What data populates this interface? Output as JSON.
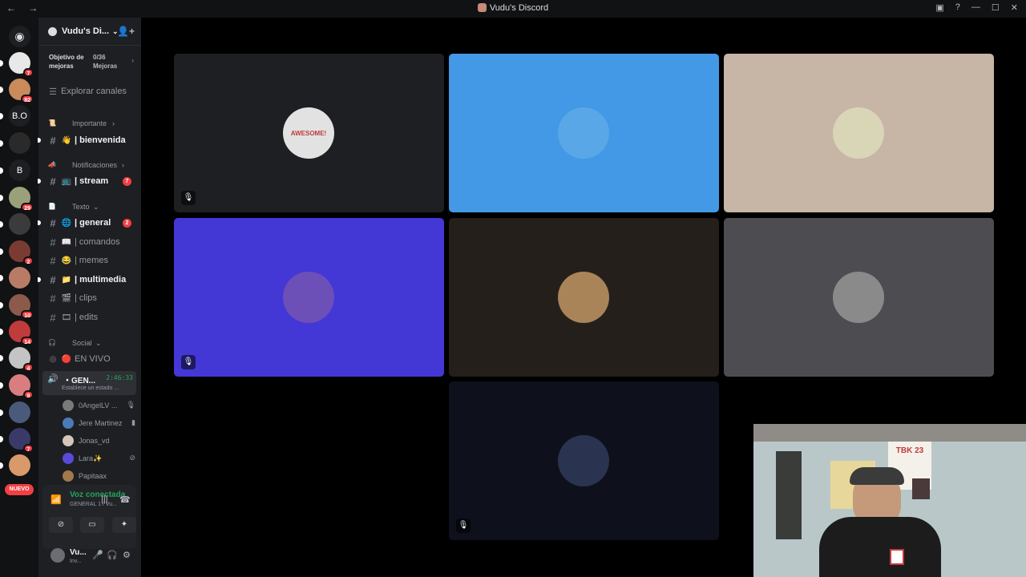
{
  "window": {
    "title": "Vudu's Discord",
    "nav_arrows": "← →",
    "controls": [
      "▣",
      "?",
      "—",
      "☐",
      "✕"
    ]
  },
  "servers": [
    {
      "label": "",
      "badge": "7",
      "color": "#e8e8e8"
    },
    {
      "label": "",
      "badge": "82",
      "color": "#c98a5c"
    },
    {
      "label": "B.O",
      "badge": "",
      "color": "#1e1f22"
    },
    {
      "label": "",
      "badge": "",
      "color": "#2a2a2a"
    },
    {
      "label": "B",
      "badge": "",
      "color": "#1e1f22"
    },
    {
      "label": "",
      "badge": "29",
      "color": "#9aa07a"
    },
    {
      "label": "",
      "badge": "",
      "color": "#3b3b3b"
    },
    {
      "label": "",
      "badge": "2",
      "color": "#7a3c32"
    },
    {
      "label": "",
      "badge": "",
      "color": "#b87c66"
    },
    {
      "label": "",
      "badge": "10",
      "color": "#8b5a4a"
    },
    {
      "label": "",
      "badge": "14",
      "color": "#c03b3b"
    },
    {
      "label": "",
      "badge": "4",
      "color": "#c4c4c4"
    },
    {
      "label": "",
      "badge": "9",
      "color": "#d87e7e"
    },
    {
      "label": "",
      "badge": "",
      "color": "#4a5a7a"
    },
    {
      "label": "",
      "badge": "7",
      "color": "#3a3a6a"
    },
    {
      "label": "",
      "badge": "",
      "color": "#d89a6a"
    }
  ],
  "nuevo_label": "NUEVO",
  "guild": {
    "name": "Vudu's Di...",
    "boost_goal": "Objetivo de mejoras",
    "boost_count": "0/36 Mejoras",
    "explore": "Explorar canales"
  },
  "categories": {
    "importante": "Importante",
    "notificaciones": "Notificaciones",
    "texto": "Texto",
    "social": "Social"
  },
  "channels": {
    "bienvenida": {
      "emoji": "👋",
      "name": "| bienvenida"
    },
    "stream": {
      "emoji": "📺",
      "name": "| stream",
      "badge": "7"
    },
    "general": {
      "emoji": "🌐",
      "name": "| general",
      "badge": "2"
    },
    "comandos": {
      "emoji": "📖",
      "name": "| comandos"
    },
    "memes": {
      "emoji": "😂",
      "name": "| memes"
    },
    "multimedia": {
      "emoji": "📁",
      "name": "| multimedia"
    },
    "clips": {
      "emoji": "🎬",
      "name": "| clips"
    },
    "edits": {
      "emoji": "🎞",
      "name": "| edits"
    },
    "envivo": {
      "emoji": "🔴",
      "name": "EN VIVO"
    }
  },
  "voice_channel": {
    "name": "・GEN...",
    "timer": "2:46:33",
    "status": "Establece un estado ..."
  },
  "voice_users": [
    {
      "name": "0AngelLV ...",
      "color": "#7a7a7a",
      "icon": "🎙"
    },
    {
      "name": "Jere Martinez",
      "color": "#4a7ab8",
      "icon": "▮"
    },
    {
      "name": "Jonas_vd",
      "color": "#d4c6b8",
      "icon": ""
    },
    {
      "name": "Lara✨",
      "color": "#5a4ad8",
      "icon": "⊘"
    },
    {
      "name": "Papitaax",
      "color": "#a07a4a",
      "icon": ""
    }
  ],
  "voice_panel": {
    "connected": "Voz conectada",
    "channel": "GENERAL 1 / Vu..."
  },
  "user_panel": {
    "name": "Vu...",
    "status": "Inv..."
  },
  "tiles": [
    {
      "bg": "#1e1f22",
      "avatar_color": "#e2e2e2",
      "avatar_text": "AWESOME!",
      "muted": true
    },
    {
      "bg": "#4399e5",
      "avatar_color": "#5aa7e8",
      "avatar_text": "",
      "muted": false
    },
    {
      "bg": "#c7b5a5",
      "avatar_color": "#d9d6b8",
      "avatar_text": "",
      "muted": false
    },
    {
      "bg": "#4338d6",
      "avatar_color": "#6d4fb8",
      "avatar_text": "",
      "muted": true
    },
    {
      "bg": "#251f1c",
      "avatar_color": "#a88458",
      "avatar_text": "",
      "muted": false
    },
    {
      "bg": "#4d4d51",
      "avatar_color": "#8a8a8a",
      "avatar_text": "",
      "muted": false
    },
    {
      "bg": "#0e111b",
      "avatar_color": "#2a3450",
      "avatar_text": "",
      "muted": true
    }
  ],
  "webcam": {
    "poster_text": "TBK 23"
  }
}
